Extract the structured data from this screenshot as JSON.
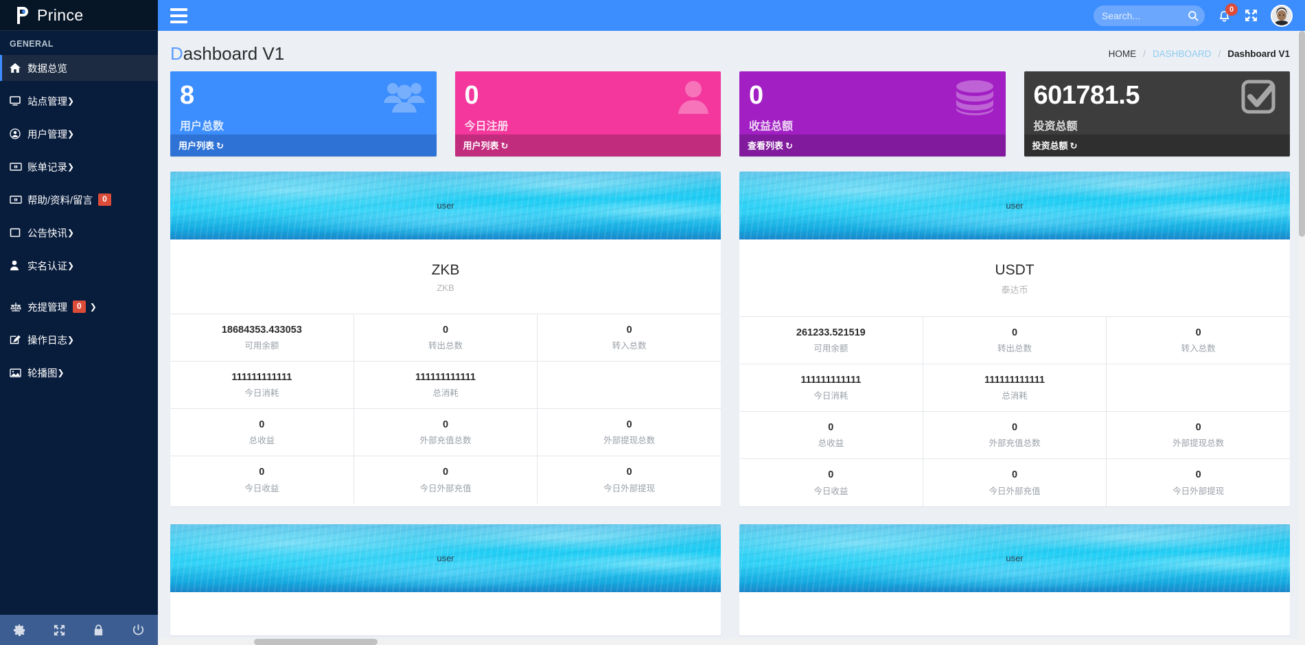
{
  "brand": {
    "name": "Prince",
    "logo_icon": "prince-p-logo-icon"
  },
  "sidebar": {
    "section_header": "GENERAL",
    "items": [
      {
        "label": "数据总览",
        "icon": "home-icon",
        "active": true,
        "caret": false,
        "badge": null
      },
      {
        "label": "站点管理",
        "icon": "monitor-icon",
        "active": false,
        "caret": true,
        "badge": null
      },
      {
        "label": "用户管理",
        "icon": "user-circle-icon",
        "active": false,
        "caret": true,
        "badge": null
      },
      {
        "label": "账单记录",
        "icon": "money-bill-icon",
        "active": false,
        "caret": true,
        "badge": null
      },
      {
        "label": "帮助/资料/留言",
        "icon": "money-bill-icon",
        "active": false,
        "caret": false,
        "badge": "0"
      },
      {
        "label": "公告快讯",
        "icon": "square-icon",
        "active": false,
        "caret": true,
        "badge": null
      },
      {
        "label": "实名认证",
        "icon": "person-icon",
        "active": false,
        "caret": true,
        "badge": null
      },
      {
        "label": "充提管理",
        "icon": "balance-scale-icon",
        "active": false,
        "caret": true,
        "badge": "0"
      },
      {
        "label": "操作日志",
        "icon": "edit-pencil-icon",
        "active": false,
        "caret": true,
        "badge": null
      },
      {
        "label": "轮播图",
        "icon": "image-icon",
        "active": false,
        "caret": true,
        "badge": null
      }
    ],
    "footer_icons": [
      {
        "name": "gear-icon"
      },
      {
        "name": "expand-arrows-icon"
      },
      {
        "name": "lock-icon"
      },
      {
        "name": "power-off-icon"
      }
    ]
  },
  "topbar": {
    "menu_toggle_icon": "hamburger-icon",
    "search": {
      "placeholder": "Search...",
      "value": "",
      "icon": "search-icon"
    },
    "notifications": {
      "icon": "bell-icon",
      "count": "0"
    },
    "fullscreen_icon": "expand-arrows-icon",
    "avatar": {
      "icon": "user-avatar"
    }
  },
  "page": {
    "title_cap": "D",
    "title_rest": "ashboard V1",
    "breadcrumb": [
      {
        "label": "HOME",
        "type": "plain"
      },
      {
        "label": "DASHBOARD",
        "type": "link"
      },
      {
        "label": "Dashboard V1",
        "type": "current"
      }
    ],
    "breadcrumb_sep": "/"
  },
  "stat_cards": [
    {
      "value": "8",
      "label": "用户总数",
      "footer": "用户列表",
      "footer_arrow": "↻",
      "icon": "users-group-icon",
      "color": "#3c8dfd",
      "foot_color": "#2f72d6"
    },
    {
      "value": "0",
      "label": "今日注册",
      "footer": "用户列表",
      "footer_arrow": "↻",
      "icon": "user-single-icon",
      "color": "#f4379c",
      "foot_color": "#c22c7d"
    },
    {
      "value": "0",
      "label": "收益总额",
      "footer": "查看列表",
      "footer_arrow": "↻",
      "icon": "database-icon",
      "color": "#a21fc4",
      "foot_color": "#811a9c"
    },
    {
      "value": "601781.5",
      "label": "投资总额",
      "footer": "投资总额",
      "footer_arrow": "↻",
      "icon": "check-square-icon",
      "color": "#3d3d3d",
      "foot_color": "#2f2f2f"
    }
  ],
  "coin_cards": [
    {
      "banner_text": "user",
      "title": "ZKB",
      "subtitle": "ZKB",
      "rows": [
        [
          {
            "value": "18684353.433053",
            "label": "可用余额"
          },
          {
            "value": "0",
            "label": "转出总数"
          },
          {
            "value": "0",
            "label": "转入总数"
          }
        ],
        [
          {
            "value": "111111111111",
            "label": "今日消耗"
          },
          {
            "value": "111111111111",
            "label": "总消耗"
          },
          {
            "value": "",
            "label": ""
          }
        ],
        [
          {
            "value": "0",
            "label": "总收益"
          },
          {
            "value": "0",
            "label": "外部充值总数"
          },
          {
            "value": "0",
            "label": "外部提现总数"
          }
        ],
        [
          {
            "value": "0",
            "label": "今日收益"
          },
          {
            "value": "0",
            "label": "今日外部充值"
          },
          {
            "value": "0",
            "label": "今日外部提现"
          }
        ]
      ]
    },
    {
      "banner_text": "user",
      "title": "USDT",
      "subtitle": "泰达币",
      "rows": [
        [
          {
            "value": "261233.521519",
            "label": "可用余额"
          },
          {
            "value": "0",
            "label": "转出总数"
          },
          {
            "value": "0",
            "label": "转入总数"
          }
        ],
        [
          {
            "value": "111111111111",
            "label": "今日消耗"
          },
          {
            "value": "111111111111",
            "label": "总消耗"
          },
          {
            "value": "",
            "label": ""
          }
        ],
        [
          {
            "value": "0",
            "label": "总收益"
          },
          {
            "value": "0",
            "label": "外部充值总数"
          },
          {
            "value": "0",
            "label": "外部提现总数"
          }
        ],
        [
          {
            "value": "0",
            "label": "今日收益"
          },
          {
            "value": "0",
            "label": "今日外部充值"
          },
          {
            "value": "0",
            "label": "今日外部提现"
          }
        ]
      ]
    }
  ],
  "coin_cards_partial": [
    {
      "banner_text": "user"
    },
    {
      "banner_text": "user"
    }
  ]
}
